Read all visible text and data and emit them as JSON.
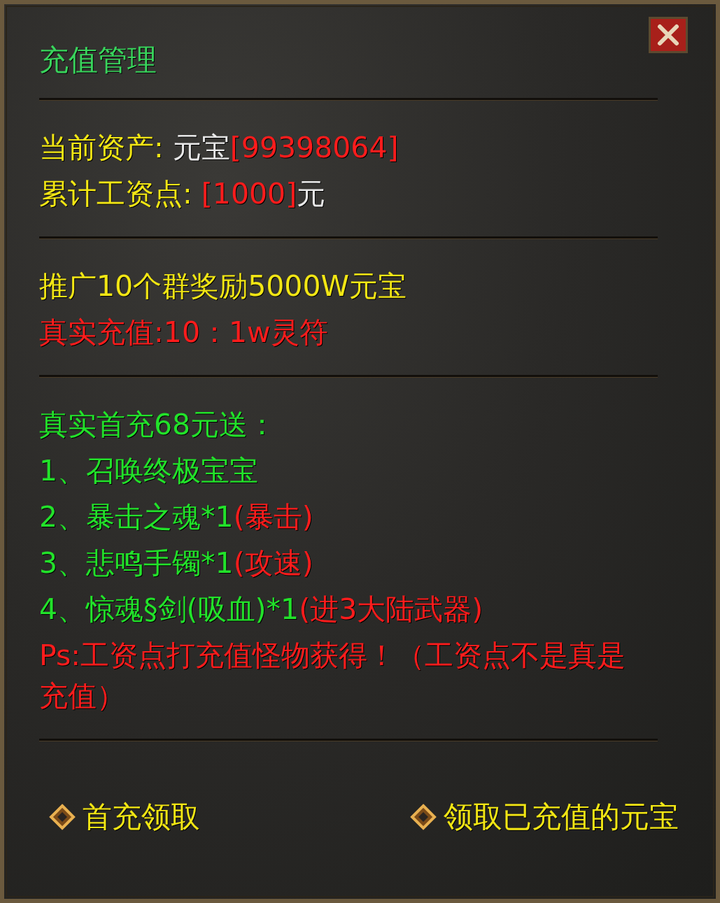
{
  "title": "充值管理",
  "sections": [
    {
      "lines": [
        [
          {
            "text": "当前资产: ",
            "color": "#f2e614"
          },
          {
            "text": "元宝",
            "color": "#e8e8e8"
          },
          {
            "text": "[99398064]",
            "color": "#ff1c1c"
          }
        ],
        [
          {
            "text": "累计工资点: ",
            "color": "#f2e614"
          },
          {
            "text": "[1000]",
            "color": "#ff1c1c"
          },
          {
            "text": "元",
            "color": "#e8e8e8"
          }
        ]
      ]
    },
    {
      "lines": [
        [
          {
            "text": "推广10个群奖励5000W元宝",
            "color": "#f2e614"
          }
        ],
        [
          {
            "text": "真实充值:10：1w灵符",
            "color": "#ff1c1c"
          }
        ]
      ]
    },
    {
      "lines": [
        [
          {
            "text": "真实首充68元送：",
            "color": "#22e22a"
          }
        ],
        [
          {
            "text": "1、召唤终极宝宝",
            "color": "#22e22a"
          }
        ],
        [
          {
            "text": "2、暴击之魂*1",
            "color": "#22e22a"
          },
          {
            "text": "(暴击)",
            "color": "#ff1c1c"
          }
        ],
        [
          {
            "text": "3、悲鸣手镯*1",
            "color": "#22e22a"
          },
          {
            "text": "(攻速)",
            "color": "#ff1c1c"
          }
        ],
        [
          {
            "text": "4、惊魂§剑(吸血)*1",
            "color": "#22e22a"
          },
          {
            "text": "(进3大陆武器)",
            "color": "#ff1c1c"
          }
        ],
        [
          {
            "text": "Ps:工资点打充值怪物获得！（工资点不是真是充值）",
            "color": "#ff1c1c"
          }
        ]
      ]
    }
  ],
  "buttons": [
    {
      "label": "首充领取"
    },
    {
      "label": "领取已充值的元宝"
    }
  ]
}
